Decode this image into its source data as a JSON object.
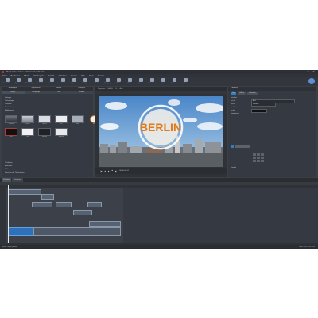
{
  "window": {
    "title": "Magix Video deluxe - Unbenanntes Projekt",
    "buttons": [
      "–",
      "□",
      "✕"
    ]
  },
  "menubar": [
    "Datei",
    "Bearbeiten",
    "Effekte",
    "Wiedergabe",
    "Ansicht",
    "Aufnahme",
    "Dienste",
    "Hilfe",
    "Shop",
    "Fenster"
  ],
  "toolbar": {
    "items": [
      "Datei öffnen",
      "Speichern",
      "Rückgängig",
      "Wiederholen",
      "Löschen",
      "Schneiden",
      "Kopieren",
      "Einfügen",
      "Titel",
      "Übergang",
      "Effekte",
      "Musik",
      "Sprache",
      "Aufnehmen",
      "Export",
      "Brennen",
      "Online"
    ]
  },
  "left_panel": {
    "tabs": [
      "Medienpool",
      "Importieren",
      "Effekte",
      "Vorlagen"
    ],
    "subtabs": [
      "Import",
      "Übergänge",
      "Titel",
      "Blenden"
    ],
    "list1": [
      "Vorlagen",
      "Titelvorlagen",
      "Untertitel",
      "Einblendungen",
      "Bildelemente"
    ],
    "row1": [
      "Standard",
      "Einfach",
      "Modern",
      "Kino",
      "Retro",
      "Berlin"
    ],
    "row2": [
      "Intro",
      "Outro",
      "Rahmen",
      "Abspann"
    ],
    "list2": [
      "Titelfarben",
      "Animation",
      "Effekte",
      "Vorschau der Titelvorlagen"
    ]
  },
  "preview": {
    "header": [
      "Programm",
      "Vollbild",
      "1:1",
      "Auto"
    ],
    "overlay_text": "BERLIN",
    "controls": [
      "|◀",
      "◀",
      "▶",
      "■",
      "▶|",
      "00:00:04:12"
    ]
  },
  "right_panel": {
    "title": "Titeleditor",
    "tabs": [
      "Text",
      "Effekte",
      "Animation"
    ],
    "rows": [
      {
        "label": "Schrift",
        "value": "Arial"
      },
      {
        "label": "Größe",
        "value": "Standard"
      },
      {
        "label": "Farbe",
        "value": ""
      }
    ],
    "sections": [
      "Schriftart",
      "Textfarbe",
      "Ausrichtung",
      "Position"
    ]
  },
  "timeline": {
    "tabs": [
      "Timeline",
      "Storyboard"
    ],
    "status_left": "Bereit: Projekt geladen",
    "status_right": "Zoom: 100%  00:01:24:08"
  },
  "colors": {
    "overlay_ring": "#ffffff",
    "overlay_text": "#e07a1a",
    "accent": "#2f7fc1"
  }
}
